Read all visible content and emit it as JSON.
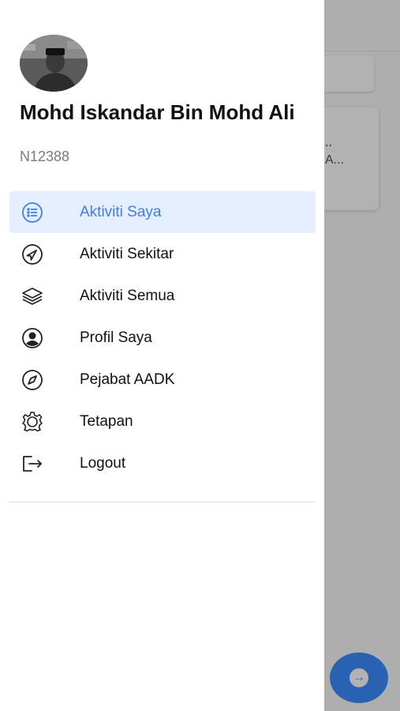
{
  "background": {
    "card_line1": "..",
    "card_line2": "A...",
    "fab_icon": "arrow-right-icon"
  },
  "drawer": {
    "user": {
      "name": "Mohd Iskandar Bin Mohd Ali",
      "id": "N12388",
      "avatar": "profile-photo"
    },
    "menu": [
      {
        "label": "Aktiviti Saya",
        "icon": "list-icon",
        "active": true
      },
      {
        "label": "Aktiviti Sekitar",
        "icon": "navigation-icon",
        "active": false
      },
      {
        "label": "Aktiviti Semua",
        "icon": "layers-icon",
        "active": false
      },
      {
        "label": "Profil Saya",
        "icon": "user-circle-icon",
        "active": false
      },
      {
        "label": "Pejabat AADK",
        "icon": "compass-icon",
        "active": false
      },
      {
        "label": "Tetapan",
        "icon": "gear-icon",
        "active": false
      },
      {
        "label": "Logout",
        "icon": "logout-icon",
        "active": false
      }
    ]
  },
  "colors": {
    "accent": "#3f7ee8",
    "active_bg": "#e6efff",
    "fab": "#3b8dff"
  }
}
